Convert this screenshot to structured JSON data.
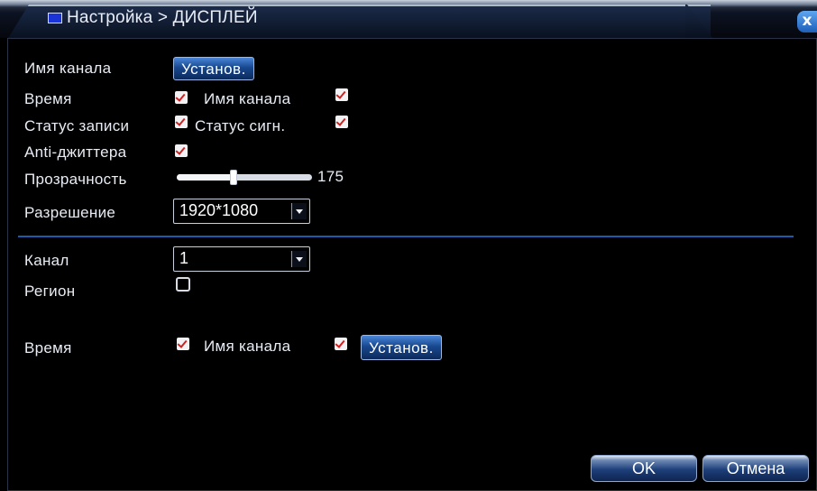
{
  "window": {
    "title": "Настройка > ДИСПЛЕЙ",
    "close_label": "x"
  },
  "display": {
    "channel_name_label": "Имя канала",
    "channel_name_button": "Установ.",
    "time_label": "Время",
    "time_checked": true,
    "channel_name_check_label": "Имя канала",
    "channel_name_checked": true,
    "record_status_label": "Статус записи",
    "record_status_checked": true,
    "alarm_status_label": "Статус сигн.",
    "alarm_status_checked": true,
    "anti_jitter_label": "Anti-джиттера",
    "anti_jitter_checked": true,
    "transparency_label": "Прозрачность",
    "transparency_value": "175",
    "transparency_fraction": 0.42,
    "resolution_label": "Разрешение",
    "resolution_value": "1920*1080"
  },
  "channel": {
    "channel_label": "Канал",
    "channel_value": "1",
    "region_label": "Регион",
    "region_checked": false,
    "time_label": "Время",
    "time_checked": true,
    "channel_name_label": "Имя канала",
    "channel_name_checked": true,
    "set_button": "Установ."
  },
  "footer": {
    "ok_label": "OK",
    "cancel_label": "Отмена"
  },
  "colors": {
    "accent": "#1f5aa8",
    "checkmark": "#d02020"
  }
}
